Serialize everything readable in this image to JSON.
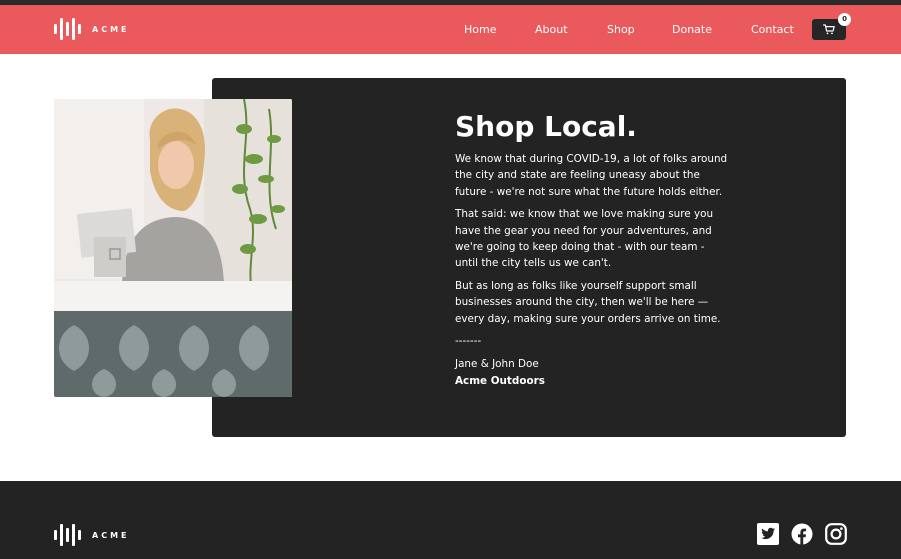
{
  "header": {
    "logo_text": "ACME",
    "nav": [
      {
        "label": "Home"
      },
      {
        "label": "About"
      },
      {
        "label": "Shop"
      },
      {
        "label": "Donate"
      },
      {
        "label": "Contact"
      }
    ],
    "cart_count": "0"
  },
  "main": {
    "title": "Shop Local.",
    "paragraphs": [
      "We know that during COVID-19, a lot of folks around the city and state are feeling uneasy about the future - we're not sure what the future holds either.",
      "That said: we know that we love making sure you have the gear you need for your adventures, and we're going to keep doing that - with our team - until the city tells us we can't.",
      "But as long as folks like yourself support small businesses around the city, then we'll be here — every day, making sure your orders arrive on time."
    ],
    "divider": "-------",
    "signature_names": "Jane & John Doe",
    "signature_company": "Acme Outdoors"
  },
  "footer": {
    "logo_text": "ACME",
    "social": [
      "twitter-icon",
      "facebook-icon",
      "instagram-icon"
    ]
  },
  "colors": {
    "header_bg": "#ea5a5c",
    "card_bg": "#232323",
    "footer_bg": "#232323"
  }
}
